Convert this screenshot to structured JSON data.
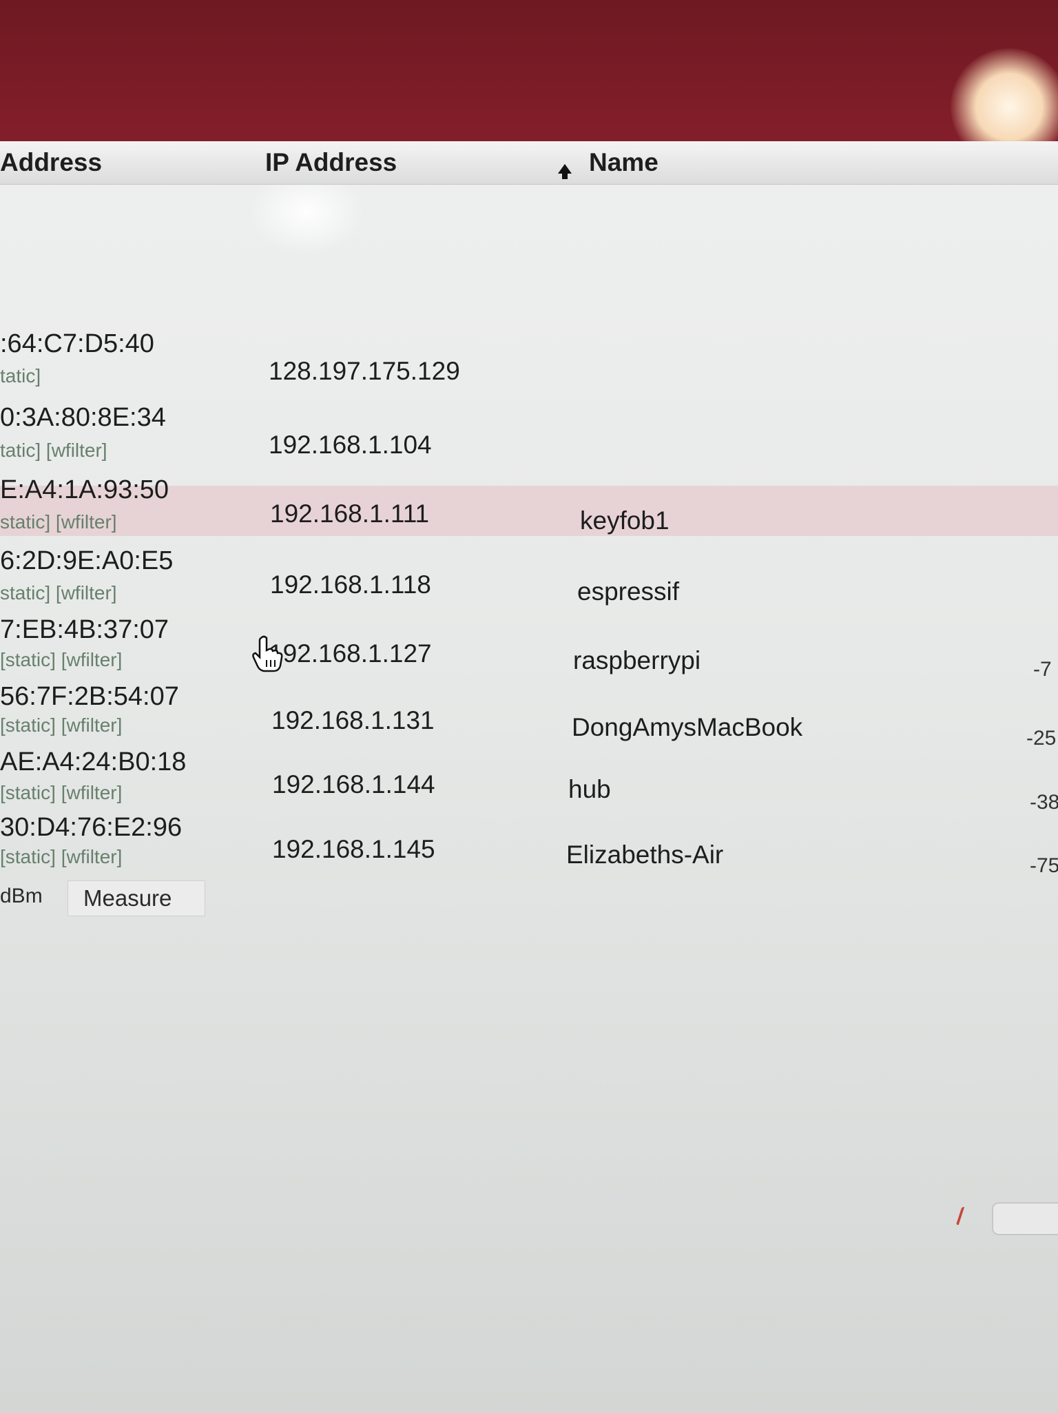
{
  "columns": {
    "mac_header": "Address",
    "ip_header": "IP Address",
    "name_header": "Name"
  },
  "rows": [
    {
      "mac": ":64:C7:D5:40",
      "tags": "tatic]",
      "ip": "128.197.175.129",
      "name": "",
      "rssi": ""
    },
    {
      "mac": "0:3A:80:8E:34",
      "tags": "tatic] [wfilter]",
      "ip": "192.168.1.104",
      "name": "",
      "rssi": ""
    },
    {
      "mac": "E:A4:1A:93:50",
      "tags": "static] [wfilter]",
      "ip": "192.168.1.111",
      "name": "keyfob1",
      "rssi": ""
    },
    {
      "mac": "6:2D:9E:A0:E5",
      "tags": "static] [wfilter]",
      "ip": "192.168.1.118",
      "name": "espressif",
      "rssi": ""
    },
    {
      "mac": "7:EB:4B:37:07",
      "tags": "[static] [wfilter]",
      "ip": "192.168.1.127",
      "name": "raspberrypi",
      "rssi": "-7"
    },
    {
      "mac": "56:7F:2B:54:07",
      "tags": "[static] [wfilter]",
      "ip": "192.168.1.131",
      "name": "DongAmysMacBook",
      "rssi": "-25"
    },
    {
      "mac": "AE:A4:24:B0:18",
      "tags": "[static] [wfilter]",
      "ip": "192.168.1.144",
      "name": "hub",
      "rssi": "-38"
    },
    {
      "mac": "30:D4:76:E2:96",
      "tags": "[static] [wfilter]",
      "ip": "192.168.1.145",
      "name": "Elizabeths-Air",
      "rssi": "-75"
    }
  ],
  "footer": {
    "unit_label": "dBm",
    "measure_label": "Measure"
  },
  "selected_row_index": 4,
  "colors": {
    "title_bar": "#7d1c27",
    "selected_row": "#e7d3d6",
    "tag_text": "#67806d"
  },
  "icons": {
    "sort": "sort-ascending-icon",
    "cursor": "hand-pointer-icon"
  }
}
